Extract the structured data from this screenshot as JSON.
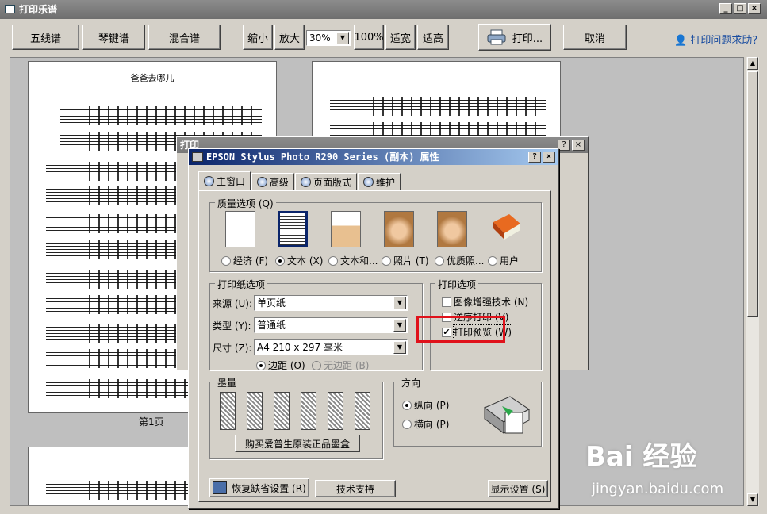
{
  "window": {
    "title": "打印乐谱",
    "min": "_",
    "max": "□",
    "close": "×"
  },
  "toolbar": {
    "staff_label": "五线谱",
    "keyboard_label": "琴键谱",
    "mixed_label": "混合谱",
    "zoom_out": "缩小",
    "zoom_in": "放大",
    "zoom_value": "30%",
    "zoom_100": "100%",
    "fit_width": "适宽",
    "fit_height": "适高",
    "print_label": "打印...",
    "cancel_label": "取消",
    "help_link": "打印问题求助?"
  },
  "preview": {
    "page1_title": "爸爸去哪儿",
    "page1_label": "第1页"
  },
  "print_dialog_bg": {
    "title": "打印"
  },
  "props_dialog": {
    "title": "EPSON Stylus Photo R290 Series (副本) 属性",
    "tabs": [
      "主窗口",
      "高级",
      "页面版式",
      "维护"
    ],
    "quality": {
      "legend": "质量选项 (Q)",
      "options": [
        "经济 (F)",
        "文本 (X)",
        "文本和...",
        "照片 (T)",
        "优质照...",
        "用户"
      ],
      "selected": "文本 (X)"
    },
    "paper": {
      "legend": "打印纸选项",
      "source_label": "来源 (U):",
      "source_value": "单页纸",
      "type_label": "类型 (Y):",
      "type_value": "普通纸",
      "size_label": "尺寸 (Z):",
      "size_value": "A4 210 x 297 毫米",
      "margin_label": "边距 (O)",
      "borderless_label": "无边距 (B)"
    },
    "print_options": {
      "legend": "打印选项",
      "enhance": "图像增强技术 (N)",
      "reverse": "逆序打印 (V)",
      "preview": "打印预览 (W)",
      "preview_checked": true
    },
    "ink": {
      "legend": "墨量",
      "buy_button": "购买爱普生原装正品墨盒"
    },
    "orientation": {
      "legend": "方向",
      "portrait": "纵向 (P)",
      "landscape": "横向 (P)"
    },
    "footer": {
      "restore": "恢复缺省设置 (R)",
      "support": "技术支持",
      "show_settings": "显示设置 (S)"
    }
  },
  "watermark": {
    "brand": "Bai 经验",
    "url": "jingyan.baidu.com"
  },
  "colors": {
    "highlight": "#e0121b",
    "link": "#1a4da0",
    "titlebar_active": "#0a246a"
  }
}
